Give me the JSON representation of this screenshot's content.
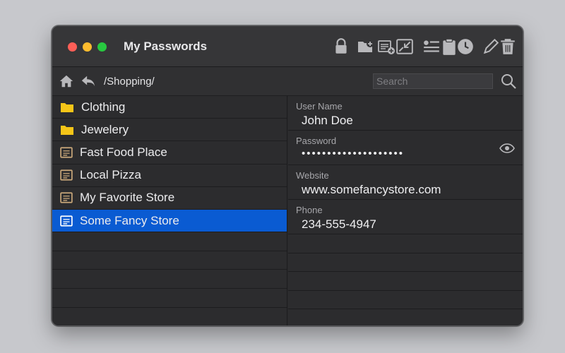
{
  "window": {
    "title": "My Passwords"
  },
  "toolbar": {
    "icons": [
      "lock-icon",
      "new-folder-icon",
      "new-entry-icon",
      "import-export-icon",
      "edit-list-icon",
      "clipboard-icon",
      "history-icon",
      "edit-icon",
      "trash-icon"
    ]
  },
  "nav": {
    "path": "/Shopping/",
    "search_placeholder": "Search"
  },
  "list": {
    "items": [
      {
        "label": "Clothing",
        "type": "folder",
        "selected": false
      },
      {
        "label": "Jewelery",
        "type": "folder",
        "selected": false
      },
      {
        "label": "Fast Food Place",
        "type": "entry",
        "selected": false
      },
      {
        "label": "Local Pizza",
        "type": "entry",
        "selected": false
      },
      {
        "label": "My Favorite Store",
        "type": "entry",
        "selected": false
      },
      {
        "label": "Some Fancy Store",
        "type": "entry",
        "selected": true
      }
    ]
  },
  "detail": {
    "fields": [
      {
        "label": "User Name",
        "value": "John Doe"
      },
      {
        "label": "Password",
        "value": "••••••••••••••••••••"
      },
      {
        "label": "Website",
        "value": "www.somefancystore.com"
      },
      {
        "label": "Phone",
        "value": "234-555-4947"
      }
    ]
  },
  "colors": {
    "selection": "#0a5bd2",
    "folder": "#f5c518",
    "entry": "#c9a77a",
    "window_bg": "#2c2c2e"
  }
}
